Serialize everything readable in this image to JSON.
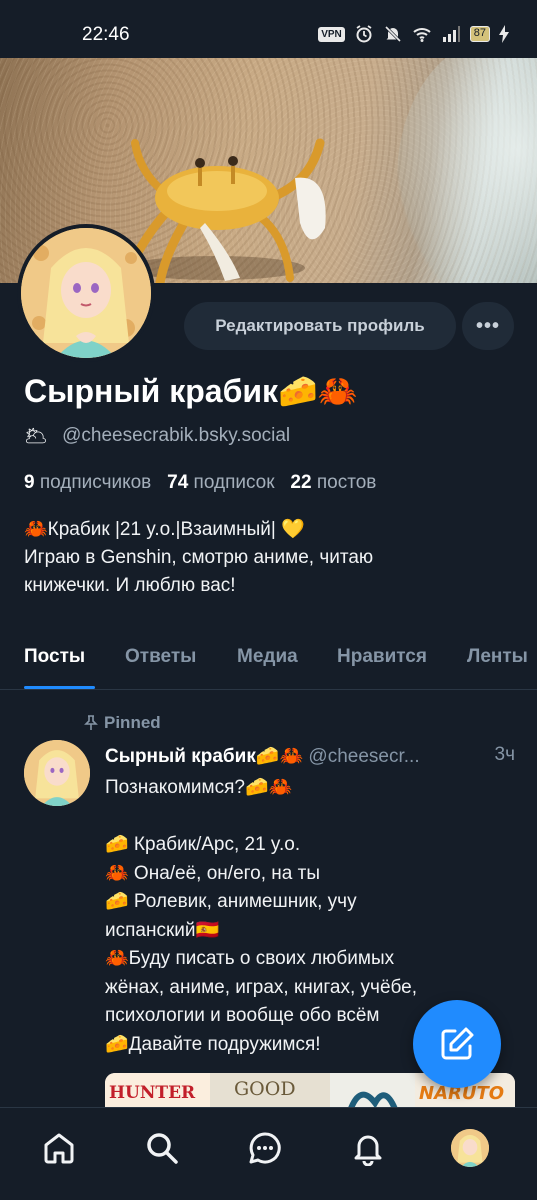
{
  "status_bar": {
    "time": "22:46",
    "vpn": "VPN",
    "battery": "87"
  },
  "profile": {
    "display_name": "Сырный крабик🧀🦀",
    "handle_emoji": "🌥",
    "handle": "@cheesecrabik.bsky.social",
    "edit_label": "Редактировать профиль",
    "more_label": "•••",
    "followers_count": "9",
    "followers_label": "подписчиков",
    "following_count": "74",
    "following_label": "подписок",
    "posts_count": "22",
    "posts_label": "постов",
    "bio_lines": [
      "🦀Крабик |21 y.o.|Взаимный| 💛",
      "Играю в Genshin, смотрю аниме, читаю",
      "книжечки. И люблю вас!"
    ]
  },
  "tabs": [
    "Посты",
    "Ответы",
    "Медиа",
    "Нравится",
    "Ленты"
  ],
  "pinned_post": {
    "pinned_label": "Pinned",
    "author": "Сырный крабик🧀🦀",
    "handle": "@cheesecr...",
    "time": "3ч",
    "lines": [
      "Познакомимся?🧀🦀",
      "",
      "🧀 Крабик/Арс, 21 y.o.",
      "🦀 Она/её, он/его, на ты",
      "🧀 Ролевик, анимешник, учу",
      "испанский🇪🇸",
      "🦀Буду писать о своих любимых",
      "жёнах, аниме, играх, книгах, учёбе,",
      "психологии и вообще обо всём",
      "🧀Давайте подружимся!"
    ],
    "media_labels": [
      "HUNTER",
      "GOOD",
      "NARUTO"
    ]
  },
  "nav": [
    "home-icon",
    "search-icon",
    "chat-icon",
    "bell-icon",
    "profile-avatar"
  ],
  "colors": {
    "accent": "#208bfe",
    "background": "#151d28",
    "muted": "#8595a6"
  }
}
